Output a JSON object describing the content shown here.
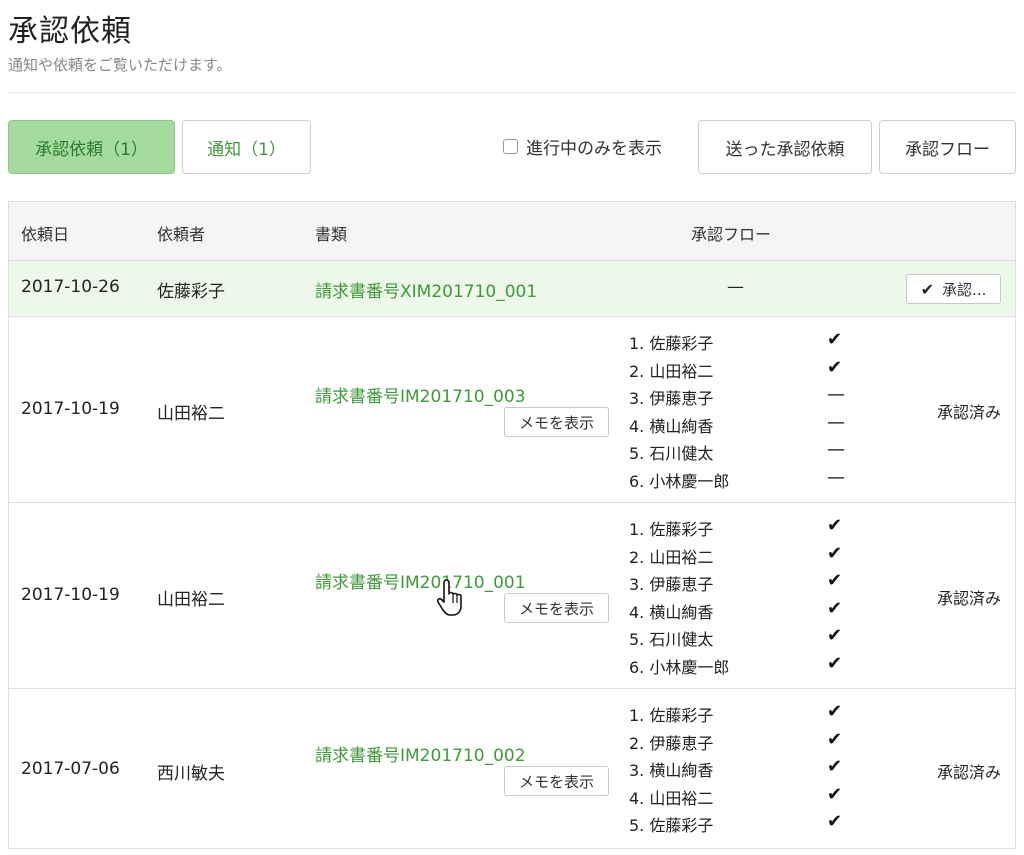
{
  "header": {
    "title": "承認依頼",
    "subtitle": "通知や依頼をご覧いただけます。"
  },
  "toolbar": {
    "tab_approval": "承認依頼（1）",
    "tab_notice": "通知（1）",
    "filter_label": "進行中のみを表示",
    "sent_label": "送った承認依頼",
    "flow_label": "承認フロー"
  },
  "table": {
    "headers": [
      "依頼日",
      "依頼者",
      "書類",
      "承認フロー"
    ],
    "rows": [
      {
        "date": "2017-10-26",
        "requester": "佐藤彩子",
        "document": "請求書番号XIM201710_001",
        "flow_placeholder": "—",
        "action": "承認...",
        "action_icon": "check-icon"
      },
      {
        "date": "2017-10-19",
        "requester": "山田裕二",
        "document": "請求書番号IM201710_003",
        "memo": "メモを表示",
        "status": "承認済み",
        "flow": [
          {
            "name": "1. 佐藤彩子",
            "mark": "✔"
          },
          {
            "name": "2. 山田裕二",
            "mark": "✔"
          },
          {
            "name": "3. 伊藤恵子",
            "mark": "—"
          },
          {
            "name": "4. 横山絢香",
            "mark": "—"
          },
          {
            "name": "5. 石川健太",
            "mark": "—"
          },
          {
            "name": "6. 小林慶一郎",
            "mark": "—"
          }
        ]
      },
      {
        "date": "2017-10-19",
        "requester": "山田裕二",
        "document": "請求書番号IM201710_001",
        "memo": "メモを表示",
        "status": "承認済み",
        "flow": [
          {
            "name": "1. 佐藤彩子",
            "mark": "✔"
          },
          {
            "name": "2. 山田裕二",
            "mark": "✔"
          },
          {
            "name": "3. 伊藤恵子",
            "mark": "✔"
          },
          {
            "name": "4. 横山絢香",
            "mark": "✔"
          },
          {
            "name": "5. 石川健太",
            "mark": "✔"
          },
          {
            "name": "6. 小林慶一郎",
            "mark": "✔"
          }
        ]
      },
      {
        "date": "2017-07-06",
        "requester": "西川敏夫",
        "document": "請求書番号IM201710_002",
        "memo": "メモを表示",
        "status": "承認済み",
        "flow": [
          {
            "name": "1. 佐藤彩子",
            "mark": "✔"
          },
          {
            "name": "2. 伊藤恵子",
            "mark": "✔"
          },
          {
            "name": "3. 横山絢香",
            "mark": "✔"
          },
          {
            "name": "4. 山田裕二",
            "mark": "✔"
          },
          {
            "name": "5. 佐藤彩子",
            "mark": "✔"
          }
        ]
      }
    ]
  },
  "colors": {
    "accent_green": "#3f9a3a",
    "active_tab_bg": "#a6dba0",
    "highlight_row_bg": "#eef8ea"
  }
}
